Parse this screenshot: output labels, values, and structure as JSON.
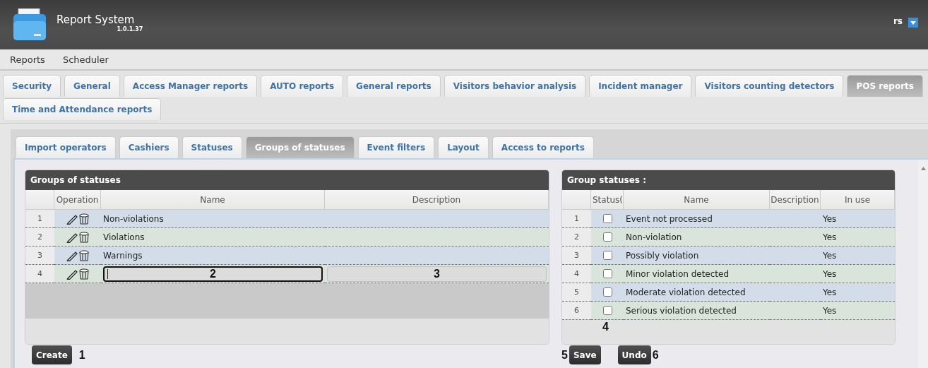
{
  "header": {
    "title": "Report System",
    "version": "1.0.1.37",
    "user": "rs"
  },
  "menu": [
    {
      "label": "Reports"
    },
    {
      "label": "Scheduler"
    }
  ],
  "report_tabs": [
    [
      {
        "label": "Security",
        "selected": false
      },
      {
        "label": "General",
        "selected": false
      },
      {
        "label": "Access Manager reports",
        "selected": false
      },
      {
        "label": "AUTO reports",
        "selected": false
      },
      {
        "label": "General reports",
        "selected": false
      },
      {
        "label": "Visitors behavior analysis",
        "selected": false
      },
      {
        "label": "Incident manager",
        "selected": false
      },
      {
        "label": "Visitors counting detectors",
        "selected": false
      },
      {
        "label": "POS reports",
        "selected": true
      }
    ],
    [
      {
        "label": "Time and Attendance reports",
        "selected": false
      }
    ]
  ],
  "pos_tabs": [
    {
      "label": "Import operators",
      "selected": false
    },
    {
      "label": "Cashiers",
      "selected": false
    },
    {
      "label": "Statuses",
      "selected": false
    },
    {
      "label": "Groups of statuses",
      "selected": true
    },
    {
      "label": "Event filters",
      "selected": false
    },
    {
      "label": "Layout",
      "selected": false
    },
    {
      "label": "Access to reports",
      "selected": false
    }
  ],
  "groups_grid": {
    "title": "Groups of statuses",
    "columns": [
      "Operation",
      "Name",
      "Description"
    ],
    "rows": [
      {
        "kind": "text",
        "number": "1",
        "name": "Non-violations"
      },
      {
        "kind": "text",
        "number": "2",
        "name": "Violations"
      },
      {
        "kind": "text",
        "number": "3",
        "name": "Warnings"
      },
      {
        "kind": "edit",
        "number": "4",
        "name_field": {
          "focused": true,
          "callout": "2"
        },
        "description_field": {
          "focused": false,
          "callout": "3"
        }
      }
    ],
    "footer": [
      {
        "kind": "button",
        "label": "Create"
      },
      {
        "kind": "callout",
        "text": "1"
      }
    ]
  },
  "statuses_grid": {
    "title": "Group statuses :",
    "columns": [
      "Status(",
      "Name",
      "Description",
      "In use"
    ],
    "rows": [
      {
        "number": "1",
        "checked": false,
        "name": "Event not processed",
        "in_use": "Yes"
      },
      {
        "number": "2",
        "checked": false,
        "name": "Non-violation",
        "in_use": "Yes"
      },
      {
        "number": "3",
        "checked": false,
        "name": "Possibly violation",
        "in_use": "Yes"
      },
      {
        "number": "4",
        "checked": false,
        "name": "Minor violation detected",
        "in_use": "Yes"
      },
      {
        "number": "5",
        "checked": false,
        "name": "Moderate violation detected",
        "in_use": "Yes"
      },
      {
        "number": "6",
        "checked": false,
        "name": "Serious violation detected",
        "in_use": "Yes"
      }
    ],
    "footer_callout": "4",
    "footer": [
      {
        "kind": "callout",
        "text": "5"
      },
      {
        "kind": "button",
        "label": "Save"
      },
      {
        "kind": "button",
        "label": "Undo"
      },
      {
        "kind": "callout",
        "text": "6"
      }
    ]
  }
}
